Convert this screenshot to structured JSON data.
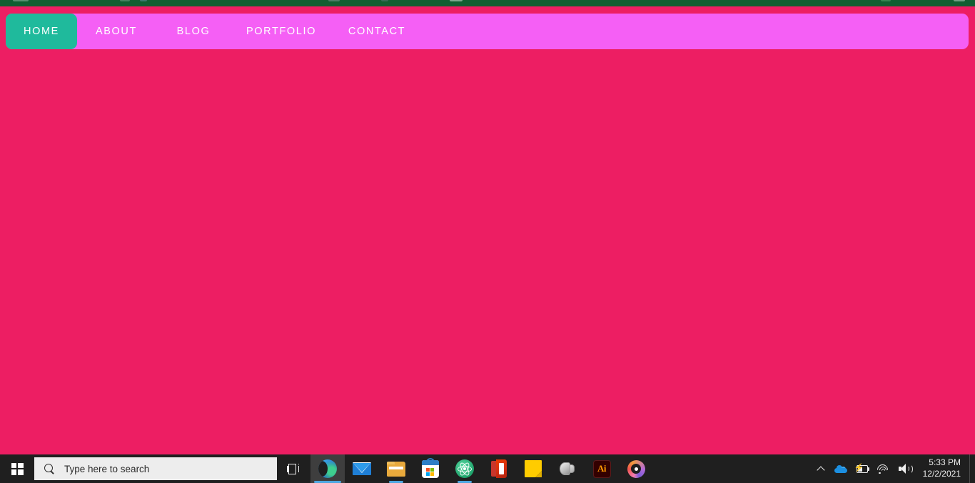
{
  "browser_chrome": {
    "description": "clipped browser window chrome strip",
    "color": "#115E31"
  },
  "website": {
    "background_color": "#ED1E63",
    "navbar": {
      "background_color": "#F55FF5",
      "active_item_color": "#1FBA9C",
      "text_color": "#FFFFFF",
      "items": [
        {
          "label": "HOME",
          "name": "home",
          "active": true
        },
        {
          "label": "ABOUT",
          "name": "about",
          "active": false
        },
        {
          "label": "BLOG",
          "name": "blog",
          "active": false
        },
        {
          "label": "PORTFOLIO",
          "name": "portfolio",
          "active": false
        },
        {
          "label": "CONTACT",
          "name": "contact",
          "active": false
        }
      ]
    },
    "content": {
      "body_text": ""
    }
  },
  "taskbar": {
    "background_color": "#1F1F1F",
    "start_button": {
      "icon": "windows-logo-icon",
      "label": "Start"
    },
    "search": {
      "placeholder": "Type here to search",
      "value": "",
      "icon": "search-icon",
      "background_color": "#EDEDED"
    },
    "task_view": {
      "icon": "task-view-icon",
      "label": "Task View"
    },
    "apps": [
      {
        "name": "microsoft-edge",
        "icon": "edge-icon",
        "label": "Microsoft Edge",
        "running": true,
        "focused": true
      },
      {
        "name": "mail",
        "icon": "mail-icon",
        "label": "Mail",
        "running": false,
        "focused": false
      },
      {
        "name": "file-explorer",
        "icon": "folder-icon",
        "label": "File Explorer",
        "running": true,
        "focused": false
      },
      {
        "name": "microsoft-store",
        "icon": "store-icon",
        "label": "Microsoft Store",
        "running": false,
        "focused": false
      },
      {
        "name": "atom",
        "icon": "atom-icon",
        "label": "Atom",
        "running": true,
        "focused": false
      },
      {
        "name": "office",
        "icon": "office-icon",
        "label": "Office",
        "running": false,
        "focused": false
      },
      {
        "name": "sticky-notes",
        "icon": "sticky-note-icon",
        "label": "Sticky Notes",
        "running": false,
        "focused": false
      },
      {
        "name": "audio-device",
        "icon": "speaker-icon",
        "label": "Audio",
        "running": false,
        "focused": false
      },
      {
        "name": "adobe-illustrator",
        "icon": "illustrator-icon",
        "label": "Adobe Illustrator",
        "running": false,
        "focused": false,
        "glyph": "Ai"
      },
      {
        "name": "media-ring-app",
        "icon": "ring-disc-icon",
        "label": "Media",
        "running": false,
        "focused": false
      }
    ],
    "tray": {
      "overflow": {
        "icon": "chevron-up-icon",
        "label": "Show hidden icons"
      },
      "onedrive": {
        "icon": "cloud-icon",
        "label": "OneDrive"
      },
      "battery": {
        "icon": "battery-charging-icon",
        "label": "Battery charging"
      },
      "network": {
        "icon": "wifi-icon",
        "label": "Network"
      },
      "volume": {
        "icon": "volume-icon",
        "label": "Volume"
      },
      "clock": {
        "time": "5:33 PM",
        "date": "12/2/2021"
      },
      "show_desktop": {
        "label": "Show desktop"
      }
    }
  }
}
